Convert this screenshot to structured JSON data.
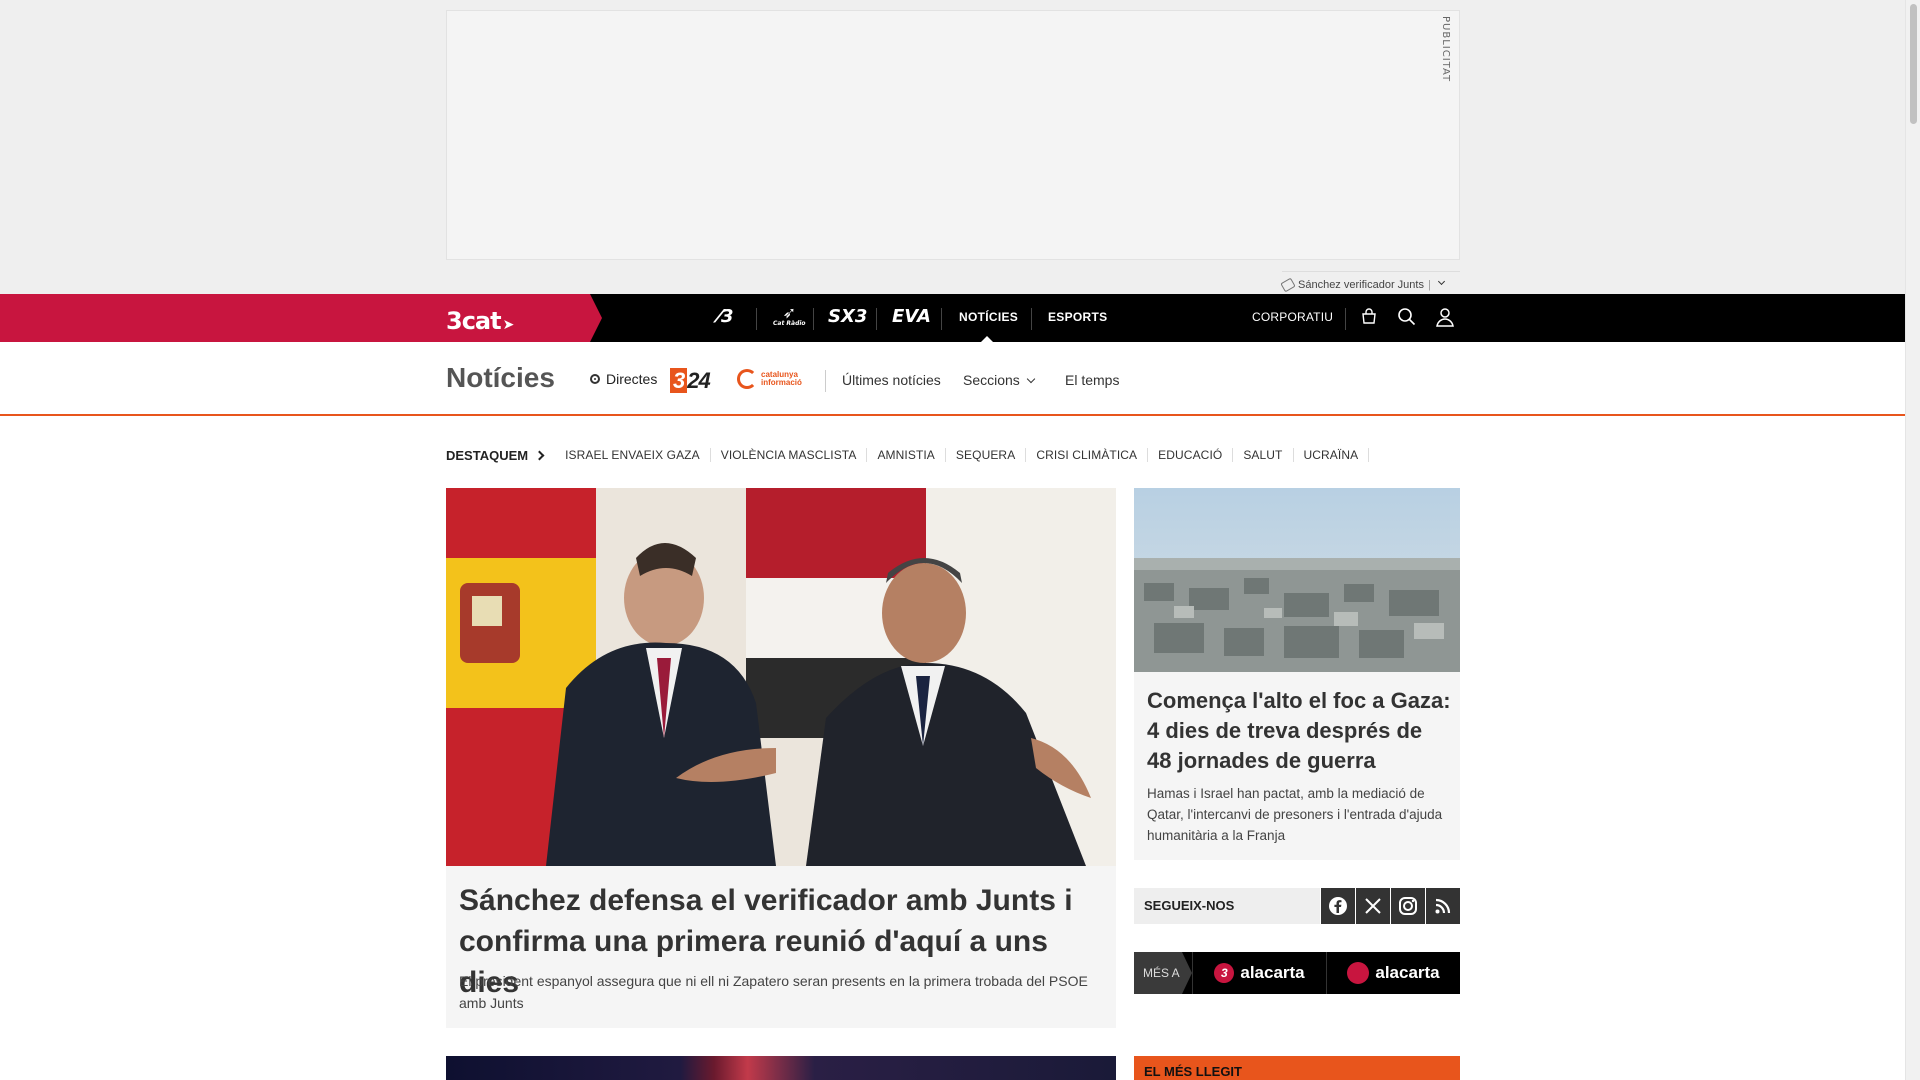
{
  "ad": {
    "label": "PUBLICITAT",
    "tag": "Sánchez verificador Junts"
  },
  "topbar": {
    "brand": "3cat",
    "channels": [
      "3",
      "Cat Ràdio",
      "SX3",
      "EVA"
    ],
    "nav": [
      "NOTÍCIES",
      "ESPORTS"
    ],
    "active": "NOTÍCIES",
    "corporate": "CORPORATIU",
    "icons": [
      "shop-icon",
      "search-icon",
      "user-icon"
    ],
    "brand_color": "#c8153f"
  },
  "section": {
    "title": "Notícies",
    "directes": "Directes",
    "logo_324": "324",
    "logo_ci": "catalunya informació",
    "links": [
      "Últimes notícies",
      "Seccions",
      "El temps"
    ],
    "accent_color": "#e8551c"
  },
  "trending": {
    "label": "DESTAQUEM",
    "items": [
      "ISRAEL ENVAEIX GAZA",
      "VIOLÈNCIA MASCLISTA",
      "AMNISTIA",
      "SEQUERA",
      "CRISI CLIMÀTICA",
      "EDUCACIÓ",
      "SALUT",
      "UCRAÏNA"
    ]
  },
  "main_story": {
    "title": "Sánchez defensa el verificador amb Junts i confirma una primera reunió d'aquí a uns dies",
    "summary": "El president espanyol assegura que ni ell ni Zapatero seran presents en la primera trobada del PSOE amb Junts"
  },
  "side_story": {
    "title": "Comença l'alto el foc a Gaza: 4 dies de treva després de 48 jornades de guerra",
    "summary": "Hamas i Israel han pactat, amb la mediació de Qatar, l'intercanvi de presoners i l'entrada d'ajuda humanitària a la Franja"
  },
  "follow": {
    "label": "SEGUEIX-NOS",
    "networks": [
      "facebook-icon",
      "x-icon",
      "instagram-icon",
      "rss-icon"
    ]
  },
  "mes_a": {
    "label": "MÉS A",
    "buttons": [
      "alacarta",
      "alacarta"
    ]
  },
  "most_read": {
    "label": "EL MÉS LLEGIT"
  }
}
